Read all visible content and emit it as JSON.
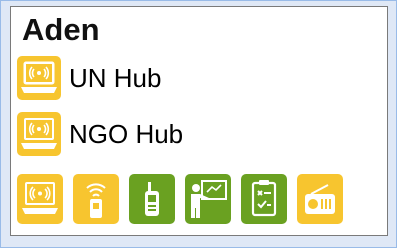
{
  "location": {
    "title": "Aden"
  },
  "hubs": [
    {
      "label": "UN Hub",
      "icon": "vsat-icon"
    },
    {
      "label": "NGO Hub",
      "icon": "vsat-icon"
    }
  ],
  "services": [
    {
      "icon": "vsat-icon",
      "color": "#f7c52f"
    },
    {
      "icon": "wifi-router-icon",
      "color": "#f7c52f"
    },
    {
      "icon": "handheld-radio-icon",
      "color": "#6aa121"
    },
    {
      "icon": "training-icon",
      "color": "#6aa121"
    },
    {
      "icon": "checklist-icon",
      "color": "#6aa121"
    },
    {
      "icon": "radio-icon",
      "color": "#f7c52f"
    }
  ],
  "colors": {
    "yellow": "#f7c52f",
    "green": "#6aa121"
  }
}
